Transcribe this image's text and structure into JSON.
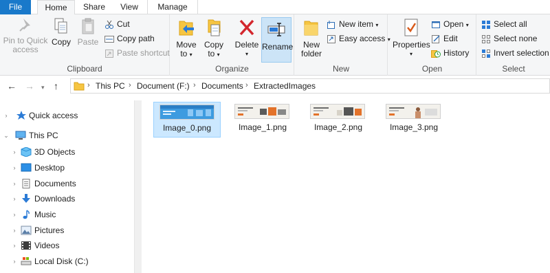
{
  "tabs": {
    "file": "File",
    "home": "Home",
    "share": "Share",
    "view": "View",
    "manage": "Manage"
  },
  "ribbon": {
    "clipboard": {
      "label": "Clipboard",
      "pin_line1": "Pin to Quick",
      "pin_line2": "access",
      "copy": "Copy",
      "paste": "Paste",
      "cut": "Cut",
      "copy_path": "Copy path",
      "paste_shortcut": "Paste shortcut"
    },
    "organize": {
      "label": "Organize",
      "move_line1": "Move",
      "move_line2": "to",
      "copy_line1": "Copy",
      "copy_line2": "to",
      "delete": "Delete",
      "rename": "Rename"
    },
    "new": {
      "label": "New",
      "folder_line1": "New",
      "folder_line2": "folder",
      "new_item": "New item",
      "easy_access": "Easy access"
    },
    "open": {
      "label": "Open",
      "properties": "Properties",
      "open": "Open",
      "edit": "Edit",
      "history": "History"
    },
    "select": {
      "label": "Select",
      "select_all": "Select all",
      "select_none": "Select none",
      "invert": "Invert selection"
    }
  },
  "address": {
    "crumbs": [
      "This PC",
      "Document (F:)",
      "Documents",
      "ExtractedImages"
    ]
  },
  "sidebar": {
    "items": [
      {
        "label": "Quick access",
        "icon": "star-icon"
      },
      {
        "label": "This PC",
        "icon": "computer-icon"
      },
      {
        "label": "3D Objects",
        "icon": "cube-icon"
      },
      {
        "label": "Desktop",
        "icon": "desktop-icon"
      },
      {
        "label": "Documents",
        "icon": "document-icon"
      },
      {
        "label": "Downloads",
        "icon": "download-icon"
      },
      {
        "label": "Music",
        "icon": "music-icon"
      },
      {
        "label": "Pictures",
        "icon": "pictures-icon"
      },
      {
        "label": "Videos",
        "icon": "video-icon"
      },
      {
        "label": "Local Disk (C:)",
        "icon": "drive-icon"
      }
    ]
  },
  "files": [
    {
      "name": "Image_0.png",
      "selected": true
    },
    {
      "name": "Image_1.png",
      "selected": false
    },
    {
      "name": "Image_2.png",
      "selected": false
    },
    {
      "name": "Image_3.png",
      "selected": false
    }
  ],
  "colors": {
    "accent": "#1979ca",
    "selection": "#cce8ff",
    "ribbon_bg": "#f5f6f7"
  }
}
